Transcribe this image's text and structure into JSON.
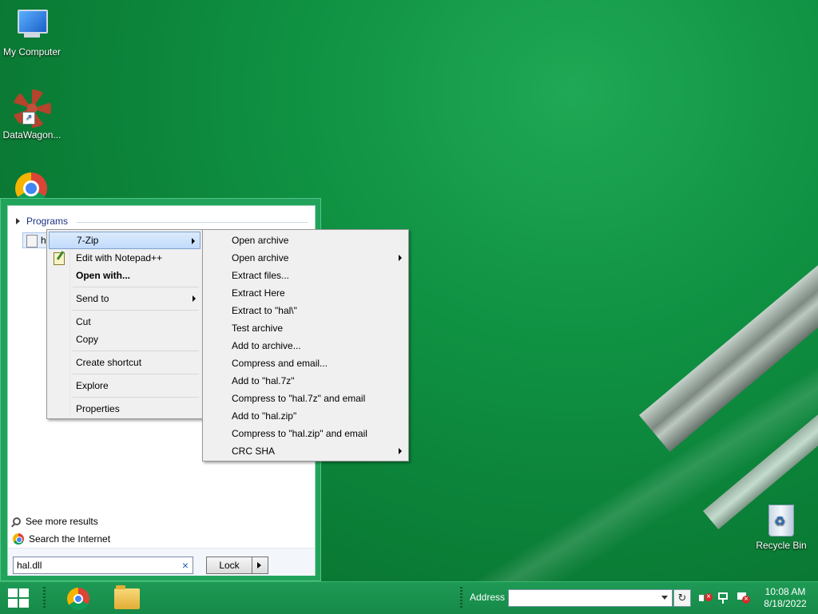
{
  "desktop": {
    "icons": [
      {
        "label": "My Computer"
      },
      {
        "label": "DataWagon..."
      },
      {
        "label": "Recycle Bin"
      }
    ]
  },
  "start_panel": {
    "programs_header": "Programs",
    "result_label": "hal.dll",
    "see_more": "See more results",
    "search_internet": "Search the Internet",
    "search_value": "hal.dll",
    "lock_label": "Lock"
  },
  "context_menu": {
    "items": [
      {
        "label": "7-Zip"
      },
      {
        "label": "Edit with Notepad++"
      },
      {
        "label": "Open with..."
      },
      {
        "label": "Send to"
      },
      {
        "label": "Cut"
      },
      {
        "label": "Copy"
      },
      {
        "label": "Create shortcut"
      },
      {
        "label": "Explore"
      },
      {
        "label": "Properties"
      }
    ]
  },
  "submenu_7zip": {
    "items": [
      {
        "label": "Open archive"
      },
      {
        "label": "Open archive"
      },
      {
        "label": "Extract files..."
      },
      {
        "label": "Extract Here"
      },
      {
        "label": "Extract to \"hal\\\""
      },
      {
        "label": "Test archive"
      },
      {
        "label": "Add to archive..."
      },
      {
        "label": "Compress and email..."
      },
      {
        "label": "Add to \"hal.7z\""
      },
      {
        "label": "Compress to \"hal.7z\" and email"
      },
      {
        "label": "Add to \"hal.zip\""
      },
      {
        "label": "Compress to \"hal.zip\" and email"
      },
      {
        "label": "CRC SHA"
      }
    ]
  },
  "taskbar": {
    "address_label": "Address",
    "address_value": "",
    "time": "10:08 AM",
    "date": "8/18/2022"
  }
}
